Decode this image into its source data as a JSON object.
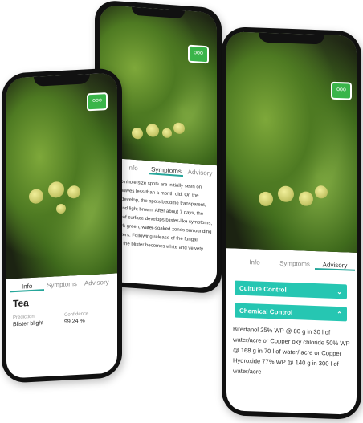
{
  "phone_left": {
    "tabs": [
      "Info",
      "Symptoms",
      "Advisory"
    ],
    "crop": "Tea",
    "prediction_label": "Prediction",
    "prediction_value": "Blister blight",
    "confidence_label": "Confidence",
    "confidence_value": "99.24 %",
    "chat_icon": "chat-icon"
  },
  "phone_middle": {
    "tabs": [
      "Info",
      "Symptoms",
      "Advisory"
    ],
    "symptoms_text": "Small, pinhole size spots are initially seen on young leaves less than a month old. On the leaves develop, the spots become transparent, larger and light brown. After about 7 days, the lower leaf surface develops blister-like symptoms, with dark green, water-soaked zones surrounding the blisters. Following release of the fungal spores, the blister becomes white and velvety"
  },
  "phone_right": {
    "tabs": [
      "Info",
      "Symptoms",
      "Advisory"
    ],
    "accordion_1": "Culture Control",
    "accordion_2": "Chemical Control",
    "chemical_text": "Bitertanol 25% WP @ 80 g in 30 l of water/acre or Copper oxy chloride 50% WP @ 168 g in 70 l of water/ acre or Copper Hydroxide 77% WP @ 140 g in 300 l of water/acre"
  }
}
